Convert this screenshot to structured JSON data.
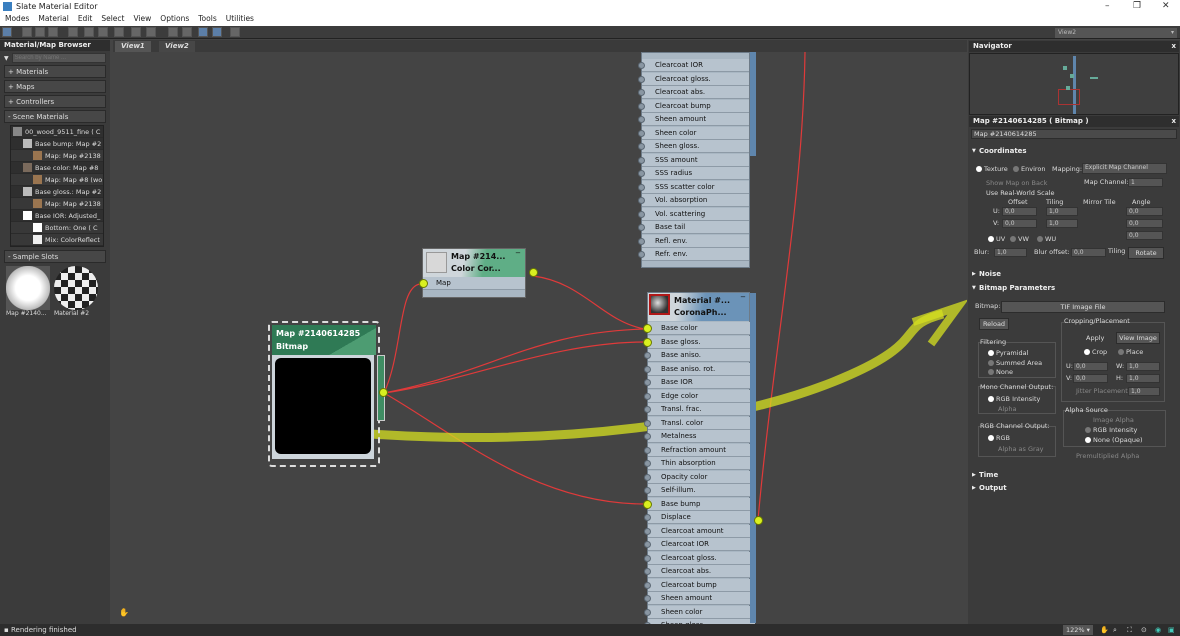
{
  "window": {
    "title": "Slate Material Editor"
  },
  "menu": [
    "Modes",
    "Material",
    "Edit",
    "Select",
    "View",
    "Options",
    "Tools",
    "Utilities"
  ],
  "browser": {
    "title": "Material/Map Browser",
    "close": "x",
    "search_placeholder": "Search by Name ...",
    "sections": [
      "+ Materials",
      "+ Maps",
      "+ Controllers",
      "- Scene Materials"
    ],
    "tree": [
      {
        "label": "00_wood_9511_fine  ( C",
        "color": "#888888",
        "indent": 0
      },
      {
        "label": "Base bump: Map #2",
        "color": "#bbbbbb",
        "indent": 1
      },
      {
        "label": "Map: Map #2138",
        "color": "#9a7550",
        "indent": 2
      },
      {
        "label": "Base color: Map #8",
        "color": "#7a6a5c",
        "indent": 1
      },
      {
        "label": "Map: Map #8 (wo",
        "color": "#9a7550",
        "indent": 2
      },
      {
        "label": "Base gloss.: Map #2",
        "color": "#bbbbbb",
        "indent": 1
      },
      {
        "label": "Map: Map #2138",
        "color": "#9a7550",
        "indent": 2
      },
      {
        "label": "Base IOR: Adjusted_",
        "color": "#ffffff",
        "indent": 1
      },
      {
        "label": "Bottom: One  ( C",
        "color": "#ffffff",
        "indent": 2
      },
      {
        "label": "Mix: ColorReflect",
        "color": "#eeeeee",
        "indent": 2
      }
    ],
    "sample_slots_title": "- Sample Slots",
    "sample_slots": [
      "Map #2140...",
      "Material #2"
    ]
  },
  "view_tabs": [
    "View1",
    "View2"
  ],
  "view_selector": "View2",
  "nodes": {
    "top_ports": [
      "Clearcoat IOR",
      "Clearcoat gloss.",
      "Clearcoat abs.",
      "Clearcoat bump",
      "Sheen amount",
      "Sheen color",
      "Sheen gloss.",
      "SSS amount",
      "SSS radius",
      "SSS scatter color",
      "Vol. absorption",
      "Vol. scattering",
      "Base tail",
      "Refl. env.",
      "Refr. env."
    ],
    "color_correct": {
      "title1": "Map #214...",
      "title2": "Color Cor...",
      "port": "Map"
    },
    "bitmap": {
      "title1": "Map #2140614285",
      "title2": "Bitmap"
    },
    "material": {
      "title1": "Material #...",
      "title2": "CoronaPh...",
      "ports": [
        "Base color",
        "Base gloss.",
        "Base aniso.",
        "Base aniso. rot.",
        "Base IOR",
        "Edge color",
        "Transl. frac.",
        "Transl. color",
        "Metalness",
        "Refraction amount",
        "Thin absorption",
        "Opacity color",
        "Self-illum.",
        "Base bump",
        "Displace",
        "Clearcoat amount",
        "Clearcoat IOR",
        "Clearcoat gloss.",
        "Clearcoat abs.",
        "Clearcoat bump",
        "Sheen amount",
        "Sheen color",
        "Sheen gloss."
      ]
    }
  },
  "navigator": {
    "title": "Navigator",
    "close": "x"
  },
  "params": {
    "header": "Map #2140614285  ( Bitmap )",
    "name_field": "Map #2140614285",
    "coordinates": {
      "title": "Coordinates",
      "texture": "Texture",
      "environ": "Environ",
      "mapping_label": "Mapping:",
      "mapping_value": "Explicit Map Channel",
      "show_map_on_back": "Show Map on Back",
      "map_channel_label": "Map Channel:",
      "map_channel": "1",
      "real_world": "Use Real-World Scale",
      "offset": "Offset",
      "tiling": "Tiling",
      "mirror_tile": "Mirror Tile",
      "angle": "Angle",
      "u_offset": "0,0",
      "v_offset": "0,0",
      "u_tiling": "1,0",
      "v_tiling": "1,0",
      "u_angle": "0,0",
      "v_angle": "0,0",
      "w_angle": "0,0",
      "uv": "UV",
      "vw": "VW",
      "wu": "WU",
      "blur_label": "Blur:",
      "blur": "1,0",
      "blur_offset_label": "Blur offset:",
      "blur_offset": "0,0",
      "rotate": "Rotate"
    },
    "noise": "Noise",
    "bitmap_params": {
      "title": "Bitmap Parameters",
      "bitmap_label": "Bitmap:",
      "bitmap_value": "TIF Image File",
      "reload": "Reload",
      "cropping": "Cropping/Placement",
      "apply": "Apply",
      "view_image": "View Image",
      "crop": "Crop",
      "place": "Place",
      "u": "0,0",
      "v": "0,0",
      "w": "1,0",
      "h": "1,0",
      "jitter": "Jitter Placement:",
      "jitter_value": "1,0",
      "filtering": "Filtering",
      "pyramidal": "Pyramidal",
      "summed": "Summed Area",
      "none": "None",
      "mono": "Mono Channel Output:",
      "rgb_intensity": "RGB Intensity",
      "alpha": "Alpha",
      "rgb_out": "RGB Channel Output:",
      "rgb": "RGB",
      "alpha_gray": "Alpha as Gray",
      "alpha_source": "Alpha Source",
      "image_alpha": "Image Alpha",
      "as_rgb_intensity": "RGB Intensity",
      "none_opaque": "None (Opaque)",
      "premult": "Premultiplied Alpha"
    },
    "time": "Time",
    "output": "Output"
  },
  "status": {
    "text": "Rendering finished",
    "zoom": "122%"
  },
  "colors": {
    "annotation": "#d6e020",
    "wire": "#e03a3a",
    "node_green": "#3f8d63"
  }
}
